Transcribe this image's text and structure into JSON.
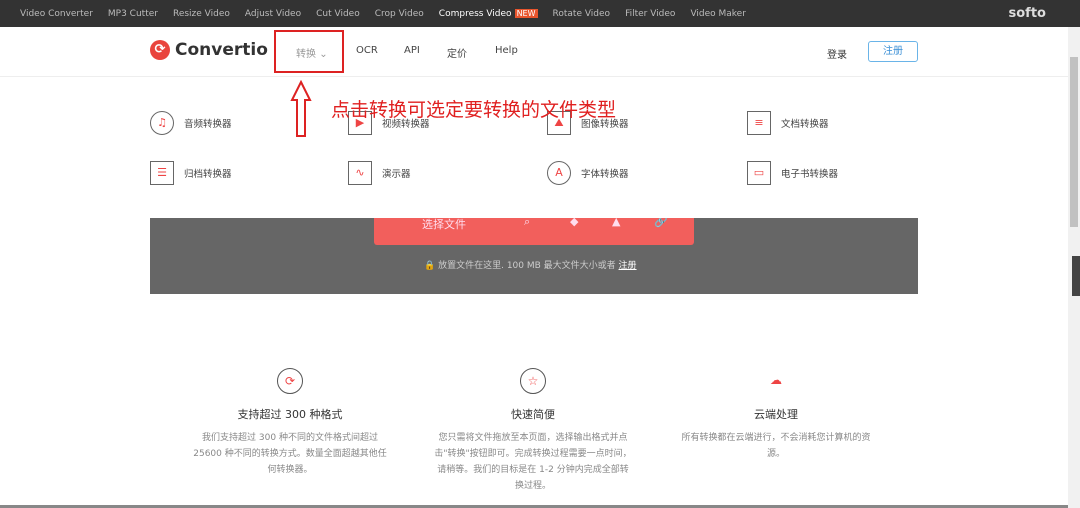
{
  "topbar": {
    "links": [
      "Video Converter",
      "MP3 Cutter",
      "Resize Video",
      "Adjust Video",
      "Cut Video",
      "Crop Video",
      "Compress Video",
      "Rotate Video",
      "Filter Video",
      "Video Maker"
    ],
    "new_badge": "NEW",
    "brand": "softo"
  },
  "nav": {
    "logo": "Convertio",
    "convert": "转换",
    "ocr": "OCR",
    "api": "API",
    "pricing": "定价",
    "help": "Help",
    "login": "登录",
    "register": "注册"
  },
  "menu": [
    "音频转换器",
    "视频转换器",
    "图像转换器",
    "文档转换器",
    "归档转换器",
    "演示器",
    "字体转换器",
    "电子书转换器"
  ],
  "annotation": "点击转换可选定要转换的文件类型",
  "hero": {
    "choose": "选择文件",
    "drop_note": "放置文件在这里. 100 MB 最大文件大小或者",
    "drop_link": "注册"
  },
  "features": [
    {
      "title": "支持超过 300 种格式",
      "text": "我们支持超过 300 种不同的文件格式间超过 25600 种不同的转换方式。数量全面超越其他任何转换器。"
    },
    {
      "title": "快速简便",
      "text": "您只需将文件拖放至本页面，选择输出格式并点击\"转换\"按钮即可。完成转换过程需要一点时间，请稍等。我们的目标是在 1-2 分钟内完成全部转换过程。"
    },
    {
      "title": "云端处理",
      "text": "所有转换都在云端进行，不会消耗您计算机的资源。"
    }
  ]
}
